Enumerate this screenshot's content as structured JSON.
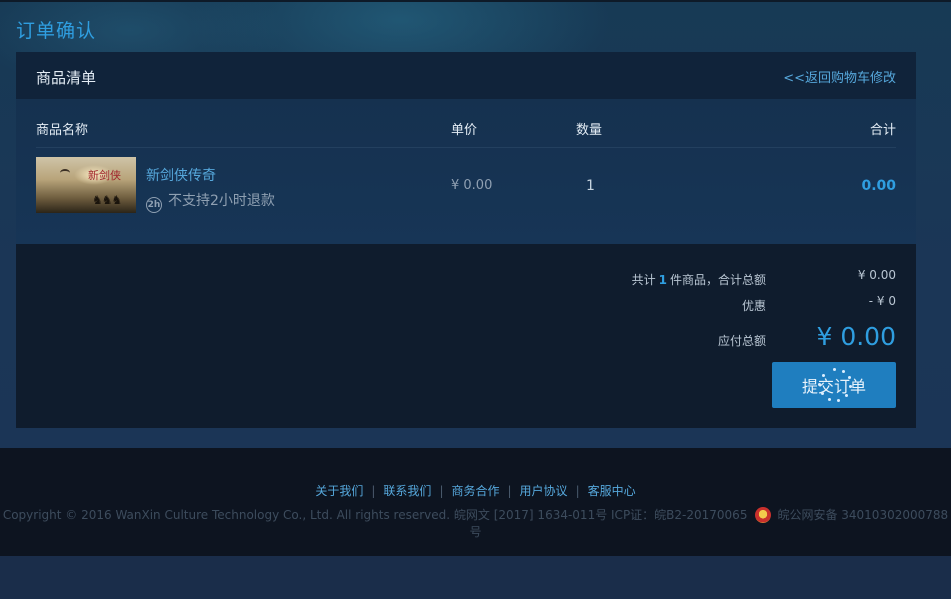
{
  "page": {
    "title": "订单确认"
  },
  "cart_panel": {
    "title": "商品清单",
    "back_link": "<<返回购物车修改"
  },
  "table": {
    "columns": [
      "商品名称",
      "单价",
      "数量",
      "合计"
    ],
    "rows": [
      {
        "name": "新剑侠传奇",
        "refund_note": "不支持2小时退款",
        "refund_icon": "2h-icon",
        "price": "¥ 0.00",
        "qty": "1",
        "total": "0.00"
      }
    ]
  },
  "summary": {
    "count_prefix": "共计",
    "count": "1",
    "count_suffix": "件商品，合计总额",
    "subtotal": "¥ 0.00",
    "discount_label": "优惠",
    "discount": "- ¥ 0",
    "payable_label": "应付总额",
    "payable": "¥ 0.00",
    "submit_label": "提交订单"
  },
  "footer": {
    "links": [
      "关于我们",
      "联系我们",
      "商务合作",
      "用户协议",
      "客服中心"
    ],
    "copyright": "Copyright © 2016 WanXin Culture Technology Co., Ltd. All rights reserved. 皖网文 [2017] 1634-011号 ICP证：皖B2-20170065",
    "police_record": "皖公网安备 34010302000788号"
  },
  "colors": {
    "accent": "#2f9ee0",
    "link": "#56a8dc",
    "button": "#1f7ebf",
    "page_bg": "#1a2d4a",
    "footer_bg": "#0d1420"
  }
}
